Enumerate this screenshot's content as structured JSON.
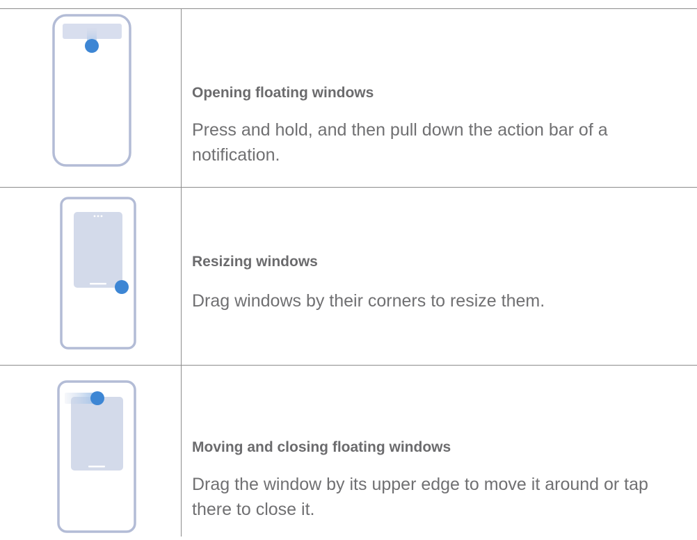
{
  "rows": [
    {
      "title": "Opening floating windows",
      "description": "Press and hold, and then pull down the action bar of a notification."
    },
    {
      "title": "Resizing windows",
      "description": "Drag windows by their corners to resize them."
    },
    {
      "title": "Moving and closing floating windows",
      "description": "Drag the window by its upper edge to move it around or tap there to close it."
    }
  ],
  "colors": {
    "phone_outline": "#b3bcd6",
    "window_fill": "#d3daea",
    "touch_point": "#3d86d4",
    "rule": "#8c8c8c",
    "text": "#707072"
  },
  "icons": [
    "phone-notification-drag-icon",
    "phone-window-resize-icon",
    "phone-window-move-icon"
  ]
}
